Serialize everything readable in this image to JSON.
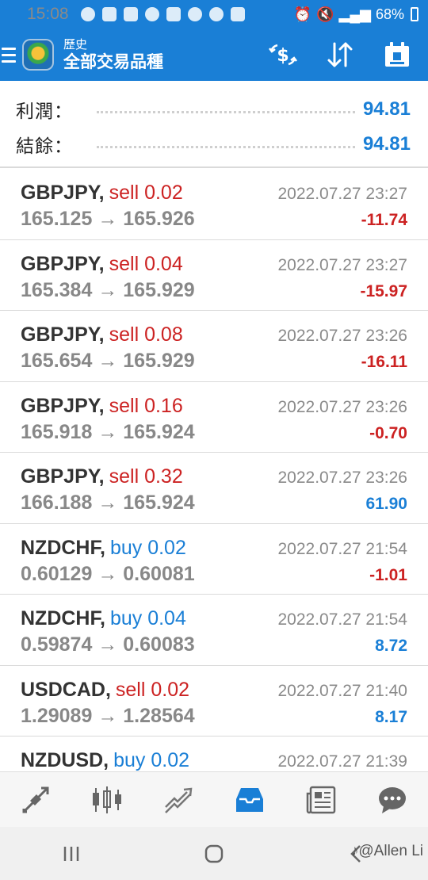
{
  "status_bar": {
    "time": "15:08",
    "battery": "68%"
  },
  "header": {
    "subtitle": "歷史",
    "title": "全部交易品種"
  },
  "summary": {
    "profit_label": "利潤：",
    "profit_value": "94.81",
    "balance_label": "結餘：",
    "balance_value": "94.81"
  },
  "trades": [
    {
      "symbol": "GBPJPY,",
      "side": "sell",
      "volume": "0.02",
      "time": "2022.07.27 23:27",
      "open": "165.125",
      "close": "165.926",
      "profit": "-11.74"
    },
    {
      "symbol": "GBPJPY,",
      "side": "sell",
      "volume": "0.04",
      "time": "2022.07.27 23:27",
      "open": "165.384",
      "close": "165.929",
      "profit": "-15.97"
    },
    {
      "symbol": "GBPJPY,",
      "side": "sell",
      "volume": "0.08",
      "time": "2022.07.27 23:26",
      "open": "165.654",
      "close": "165.929",
      "profit": "-16.11"
    },
    {
      "symbol": "GBPJPY,",
      "side": "sell",
      "volume": "0.16",
      "time": "2022.07.27 23:26",
      "open": "165.918",
      "close": "165.924",
      "profit": "-0.70"
    },
    {
      "symbol": "GBPJPY,",
      "side": "sell",
      "volume": "0.32",
      "time": "2022.07.27 23:26",
      "open": "166.188",
      "close": "165.924",
      "profit": "61.90"
    },
    {
      "symbol": "NZDCHF,",
      "side": "buy",
      "volume": "0.02",
      "time": "2022.07.27 21:54",
      "open": "0.60129",
      "close": "0.60081",
      "profit": "-1.01"
    },
    {
      "symbol": "NZDCHF,",
      "side": "buy",
      "volume": "0.04",
      "time": "2022.07.27 21:54",
      "open": "0.59874",
      "close": "0.60083",
      "profit": "8.72"
    },
    {
      "symbol": "USDCAD,",
      "side": "sell",
      "volume": "0.02",
      "time": "2022.07.27 21:40",
      "open": "1.29089",
      "close": "1.28564",
      "profit": "8.17"
    },
    {
      "symbol": "NZDUSD,",
      "side": "buy",
      "volume": "0.02",
      "time": "2022.07.27 21:39",
      "open": "",
      "close": "",
      "profit": ""
    }
  ],
  "arrow": "→",
  "icons": {
    "header": [
      "currency-exchange-icon",
      "sort-icon",
      "calendar-icon"
    ],
    "bottom_nav": [
      "quotes-icon",
      "chart-icon",
      "trade-icon",
      "history-icon",
      "news-icon",
      "chat-icon"
    ]
  },
  "colors": {
    "accent": "#1a7fd6",
    "sell": "#cc2222",
    "buy": "#1a7fd6"
  },
  "watermark": "@Allen Li"
}
